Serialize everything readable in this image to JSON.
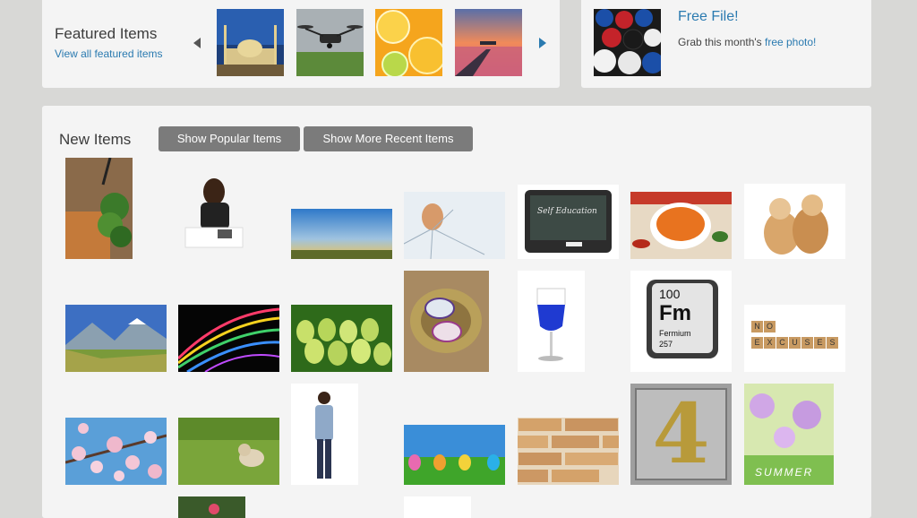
{
  "featured": {
    "title": "Featured Items",
    "view_all_label": "View all featured items"
  },
  "free_file": {
    "title": "Free File!",
    "text_prefix": "Grab this month's ",
    "link_label": "free photo!"
  },
  "new_items": {
    "title": "New Items",
    "buttons": {
      "popular": "Show Popular Items",
      "recent": "Show More Recent Items"
    }
  },
  "thumb_text": {
    "self_education": "Self Education",
    "fermium_number": "100",
    "fermium_symbol": "Fm",
    "fermium_name": "Fermium",
    "fermium_mass": "257",
    "no_excuses": [
      "N",
      "O",
      "E",
      "X",
      "C",
      "U",
      "S",
      "E",
      "S"
    ],
    "digit_four": "4",
    "summer": "SUMMER"
  }
}
